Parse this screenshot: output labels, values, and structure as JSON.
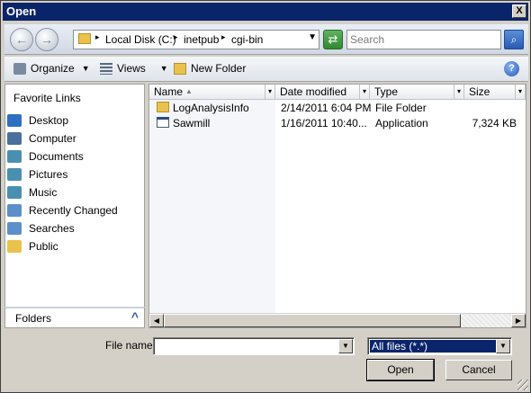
{
  "window": {
    "title": "Open",
    "close_glyph": "X"
  },
  "nav": {
    "back_glyph": "←",
    "forward_glyph": "→",
    "crumbs": [
      "Local Disk (C:)",
      "inetpub",
      "cgi-bin"
    ],
    "separator": "▸",
    "dropdown_glyph": "▼",
    "refresh_glyph": "⇄",
    "search_placeholder": "Search",
    "search_glyph": "⌕"
  },
  "toolbar": {
    "organize_label": "Organize",
    "views_label": "Views",
    "new_folder_label": "New Folder",
    "caret": "▼",
    "help_glyph": "?"
  },
  "left": {
    "title": "Favorite Links",
    "items": [
      {
        "label": "Desktop",
        "icon": "desktop-icon",
        "color": "#2f6fc2"
      },
      {
        "label": "Computer",
        "icon": "computer-icon",
        "color": "#4a6f9a"
      },
      {
        "label": "Documents",
        "icon": "documents-icon",
        "color": "#4b8fb0"
      },
      {
        "label": "Pictures",
        "icon": "pictures-icon",
        "color": "#4b8fb0"
      },
      {
        "label": "Music",
        "icon": "music-icon",
        "color": "#4b8fb0"
      },
      {
        "label": "Recently Changed",
        "icon": "recent-icon",
        "color": "#5c8fc9"
      },
      {
        "label": "Searches",
        "icon": "searches-icon",
        "color": "#5c8fc9"
      },
      {
        "label": "Public",
        "icon": "public-folder-icon",
        "color": "#e8c24d"
      }
    ],
    "folders_label": "Folders",
    "folders_chevron": "^"
  },
  "files": {
    "columns": {
      "name": "Name",
      "date": "Date modified",
      "type": "Type",
      "size": "Size"
    },
    "sort_glyph": "▲",
    "col_dropdown": "▾",
    "rows": [
      {
        "name": "LogAnalysisInfo",
        "date": "2/14/2011 6:04 PM",
        "type": "File Folder",
        "size": "",
        "icon": "folder-icon"
      },
      {
        "name": "Sawmill",
        "date": "1/16/2011 10:40...",
        "type": "Application",
        "size": "7,324 KB",
        "icon": "application-icon"
      }
    ],
    "scroll_left": "◀",
    "scroll_right": "▶"
  },
  "footer": {
    "file_name_label": "File name:",
    "file_name_value": "",
    "file_type_value": "All files (*.*)",
    "combo_glyph": "▼",
    "open_label": "Open",
    "cancel_label": "Cancel"
  },
  "colors": {
    "titlebar": "#0a246a",
    "folder": "#e8c24d"
  }
}
